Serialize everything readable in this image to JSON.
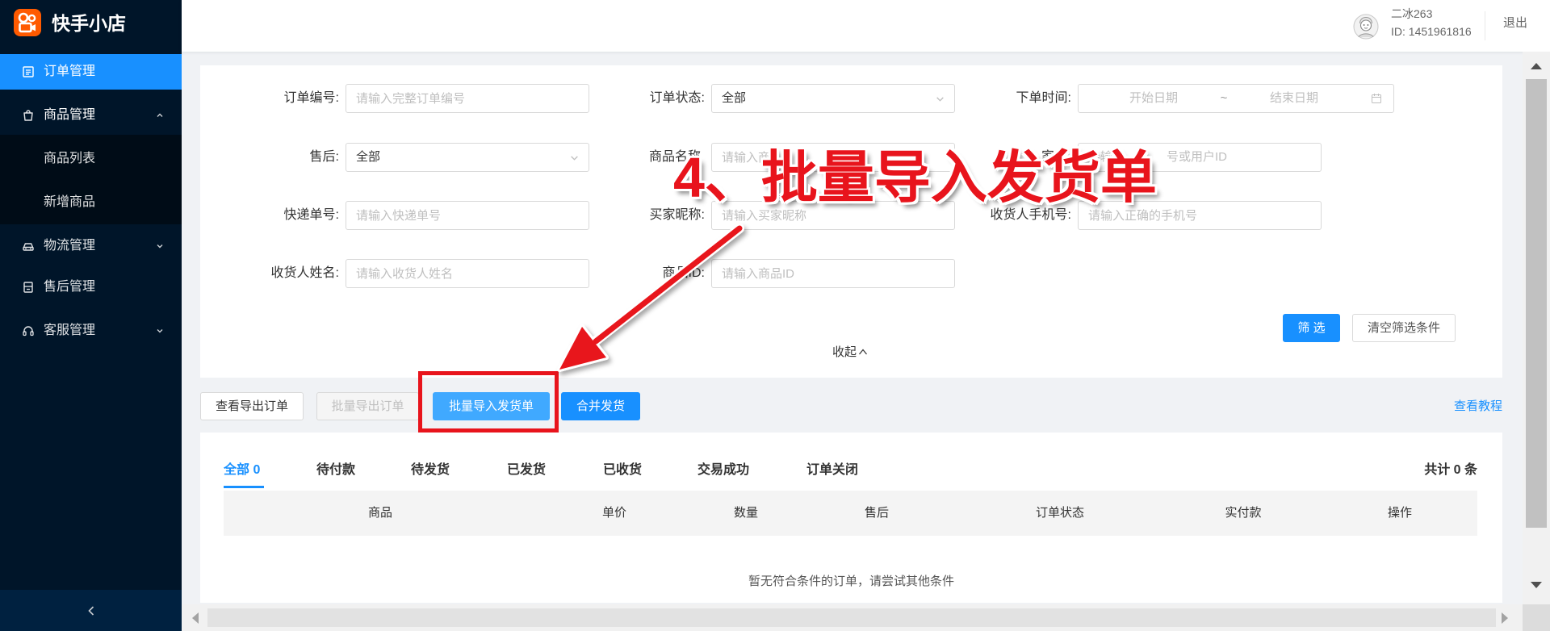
{
  "app": {
    "logo_text": "快手小店",
    "logo_icon": "kuaishou-shop-logo-icon"
  },
  "colors": {
    "primary": "#1890ff",
    "primary_light": "#40a9ff",
    "sidebar_bg": "#001529",
    "submenu_bg": "#000c17",
    "annotation_red": "#e8141c"
  },
  "sidebar": {
    "items": [
      {
        "label": "订单管理",
        "icon": "order-list-icon",
        "active": true
      },
      {
        "label": "商品管理",
        "icon": "shopping-bag-icon",
        "expanded": true,
        "children": [
          {
            "label": "商品列表"
          },
          {
            "label": "新增商品"
          }
        ]
      },
      {
        "label": "物流管理",
        "icon": "car-icon",
        "expanded": false
      },
      {
        "label": "售后管理",
        "icon": "after-sales-icon"
      },
      {
        "label": "客服管理",
        "icon": "headset-icon",
        "expanded": false
      }
    ],
    "collapse_icon": "chevron-left-icon"
  },
  "header": {
    "avatar_icon": "avatar-icon",
    "user_name": "二冰263",
    "user_id": "ID: 1451961816",
    "logout_label": "退出"
  },
  "filters": {
    "order_no": {
      "label": "订单编号:",
      "placeholder": "请输入完整订单编号"
    },
    "order_status": {
      "label": "订单状态:",
      "value": "全部"
    },
    "order_time": {
      "label": "下单时间:",
      "start_placeholder": "开始日期",
      "separator": "~",
      "end_placeholder": "结束日期"
    },
    "after_sale": {
      "label": "售后:",
      "value": "全部"
    },
    "product_name": {
      "label": "商品名称",
      "placeholder": "请输入商"
    },
    "buyer_id": {
      "label": "家ID",
      "placeholder_start": "请输",
      "placeholder_end": "号或用户ID"
    },
    "express_no": {
      "label": "快递单号:",
      "placeholder": "请输入快递单号"
    },
    "buyer_nickname": {
      "label": "买家昵称:",
      "placeholder": "请输入买家昵称"
    },
    "receiver_phone": {
      "label": "收货人手机号:",
      "placeholder": "请输入正确的手机号"
    },
    "receiver_name": {
      "label": "收货人姓名:",
      "placeholder": "请输入收货人姓名"
    },
    "product_id": {
      "label": "商品ID:",
      "placeholder": "请输入商品ID"
    },
    "search_button": "筛 选",
    "clear_button": "清空筛选条件",
    "collapse_label": "收起"
  },
  "actions": {
    "view_export": "查看导出订单",
    "batch_export": "批量导出订单",
    "batch_import": "批量导入发货单",
    "merge_ship": "合并发货",
    "tutorial": "查看教程"
  },
  "order_tabs": [
    {
      "label": "全部 0",
      "active": true
    },
    {
      "label": "待付款"
    },
    {
      "label": "待发货"
    },
    {
      "label": "已发货"
    },
    {
      "label": "已收货"
    },
    {
      "label": "交易成功"
    },
    {
      "label": "订单关闭"
    }
  ],
  "total_label": "共计 0 条",
  "table": {
    "columns": [
      "商品",
      "单价",
      "数量",
      "售后",
      "订单状态",
      "实付款",
      "操作"
    ],
    "empty_text": "暂无符合条件的订单，请尝试其他条件"
  },
  "annotation": {
    "text": "4、批量导入发货单"
  }
}
